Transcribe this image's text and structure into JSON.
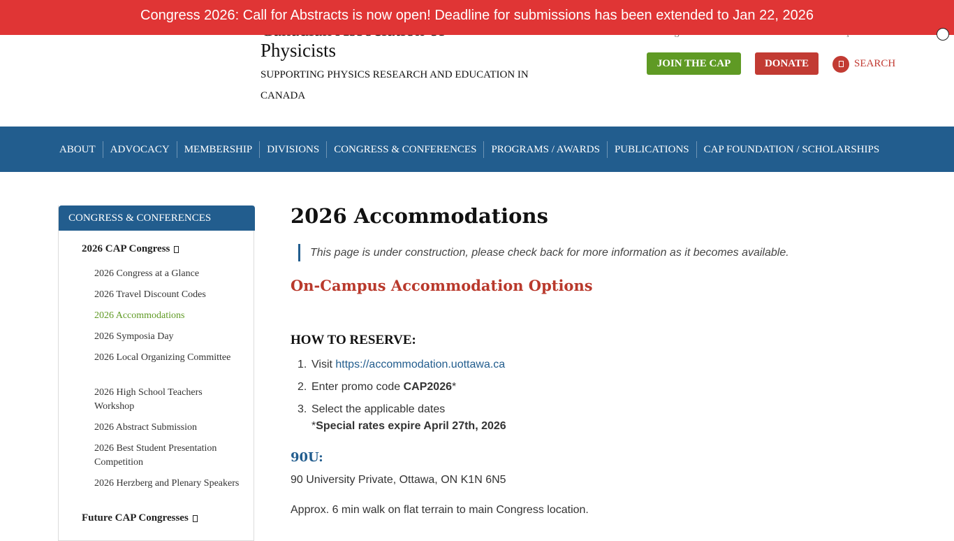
{
  "banner": {
    "text": "Congress 2026: Call for Abstracts is now open! Deadline for submissions has been extended to Jan 22, 2026"
  },
  "header": {
    "org_name_line1": "Canadian Association of",
    "org_name_line2": "Physicists",
    "tagline": "SUPPORTING PHYSICS RESEARCH AND EDUCATION IN CANADA",
    "util_links": [
      "Login",
      "Jobs",
      "Media",
      "Contact Us",
      "Français"
    ],
    "join_label": "JOIN THE CAP",
    "donate_label": "DONATE",
    "search_label": "SEARCH"
  },
  "nav": {
    "items": [
      "ABOUT",
      "ADVOCACY",
      "MEMBERSHIP",
      "DIVISIONS",
      "CONGRESS & CONFERENCES",
      "PROGRAMS / AWARDS",
      "PUBLICATIONS",
      "CAP FOUNDATION / SCHOLARSHIPS"
    ]
  },
  "sidebar": {
    "heading": "CONGRESS & CONFERENCES",
    "parent1": "2026 CAP Congress",
    "items": [
      "2026 Congress at a Glance",
      "2026 Travel Discount Codes",
      "2026 Accommodations",
      "2026 Symposia Day",
      "2026 Local Organizing Committee",
      "2026 High School Teachers Workshop",
      "2026 Abstract Submission",
      "2026 Best Student Presentation Competition",
      "2026 Herzberg and Plenary Speakers"
    ],
    "parent2": "Future CAP Congresses"
  },
  "main": {
    "title": "2026 Accommodations",
    "notice": "This page is under construction, please check back for more information as it becomes available.",
    "section_title": "On-Campus Accommodation Options",
    "how_heading": "HOW TO RESERVE:",
    "steps": [
      {
        "num": "1.",
        "text": "Visit ",
        "link": "https://accommodation.uottawa.ca"
      },
      {
        "num": "2.",
        "text": "Enter promo code ",
        "bold": "CAP2026",
        "suffix": "*"
      },
      {
        "num": "3.",
        "text": "Select the applicable dates"
      }
    ],
    "expire_star": "*",
    "expire_note": "Special rates expire April 27th, 2026",
    "sub_heading": "90U:",
    "address": "90 University Private, Ottawa, ON K1N 6N5",
    "walk": "Approx. 6 min walk on flat terrain to main Congress location."
  }
}
